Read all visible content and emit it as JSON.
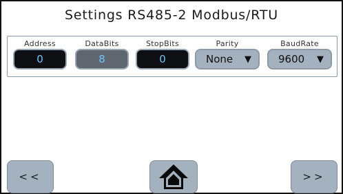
{
  "title": "Settings RS485-2 Modbus/RTU",
  "fields": {
    "address": {
      "label": "Address",
      "value": "0"
    },
    "databits": {
      "label": "DataBits",
      "value": "8"
    },
    "stopbits": {
      "label": "StopBits",
      "value": "0"
    },
    "parity": {
      "label": "Parity",
      "value": "None",
      "caret": "▼"
    },
    "baudrate": {
      "label": "BaudRate",
      "value": "9600",
      "caret": "▼"
    }
  },
  "nav": {
    "back_label": "<<",
    "home_icon": "home-icon",
    "next_label": ">>"
  },
  "colors": {
    "input_dark": "#0d0f12",
    "input_disabled": "#5f6670",
    "value_text": "#6cc7ff",
    "button_bg": "#a4b2c0"
  }
}
